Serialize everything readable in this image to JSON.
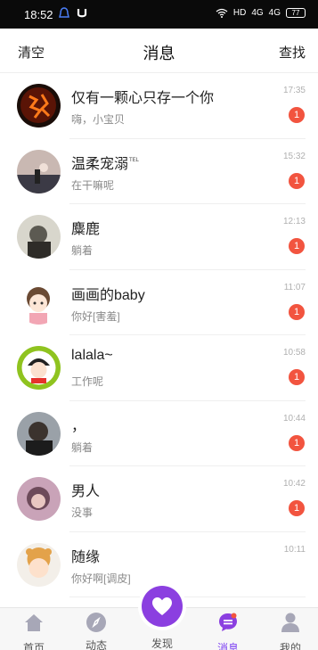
{
  "status_bar": {
    "time": "18:52",
    "network": "HD",
    "signal_1": "4G",
    "signal_2": "4G",
    "battery": "77"
  },
  "header": {
    "left_action": "清空",
    "title": "消息",
    "right_action": "查找"
  },
  "conversations": [
    {
      "name": "仅有一颗心只存一个你",
      "preview": "嗨，小宝贝",
      "time": "17:35",
      "unread": "1"
    },
    {
      "name": "温柔宠溺",
      "preview": "在干嘛呢",
      "time": "15:32",
      "unread": "1"
    },
    {
      "name": "麋鹿",
      "preview": "躺着",
      "time": "12:13",
      "unread": "1"
    },
    {
      "name": "画画的baby",
      "preview": "你好[害羞]",
      "time": "11:07",
      "unread": "1"
    },
    {
      "name": "lalala~",
      "preview": "工作呢",
      "time": "10:58",
      "unread": "1"
    },
    {
      "name": "，",
      "preview": "躺着",
      "time": "10:44",
      "unread": "1"
    },
    {
      "name": "男人",
      "preview": "没事",
      "time": "10:42",
      "unread": "1"
    },
    {
      "name": "随缘",
      "preview": "你好啊[调皮]",
      "time": "10:11",
      "unread": ""
    }
  ],
  "name_suffix_2": "TEL",
  "tabbar": {
    "home": "首页",
    "feed": "动态",
    "discover": "发现",
    "messages": "消息",
    "mine": "我的"
  },
  "colors": {
    "accent": "#8b3fe0",
    "badge": "#f2543f"
  }
}
